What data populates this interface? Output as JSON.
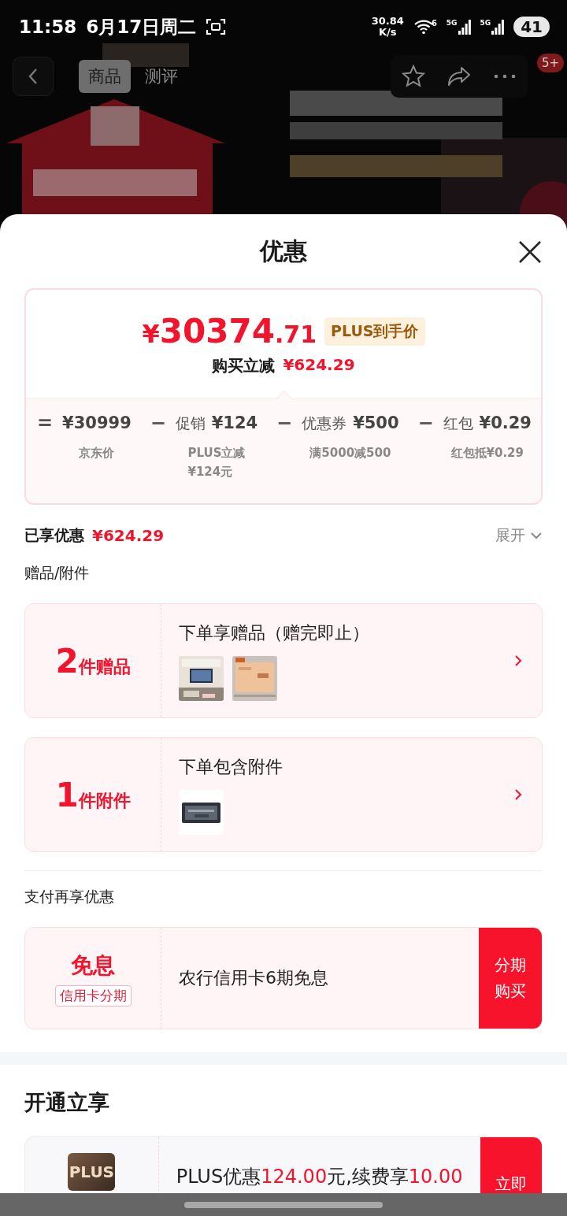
{
  "status_bar": {
    "time": "11:58",
    "date": "6月17日周二",
    "speed_value": "30.84",
    "speed_unit": "K/s",
    "wifi_label": "6",
    "signals": [
      "5G",
      "5G"
    ],
    "battery": "41"
  },
  "nav": {
    "tabs": [
      {
        "label": "商品",
        "selected": true
      },
      {
        "label": "测评",
        "selected": false
      }
    ],
    "badge": "5+"
  },
  "sheet": {
    "title": "优惠"
  },
  "price_card": {
    "price_currency": "¥",
    "price_integer": "30374",
    "price_decimal": ".71",
    "price_tag": "PLUS到手价",
    "discount_label": "购买立减",
    "discount_amount": "¥624.29",
    "breakdown": [
      {
        "operator": "=",
        "amount": "¥30999",
        "note_lines": [
          "京东价"
        ]
      },
      {
        "operator": "−",
        "label": "促销",
        "amount": "¥124",
        "note_lines": [
          "PLUS立减",
          "¥124元"
        ]
      },
      {
        "operator": "−",
        "label": "优惠券",
        "amount": "¥500",
        "note_lines": [
          "满5000减500"
        ]
      },
      {
        "operator": "−",
        "label": "红包",
        "amount": "¥0.29",
        "note_lines": [
          "红包抵¥0.29"
        ]
      }
    ]
  },
  "savings": {
    "label": "已享优惠",
    "amount": "¥624.29",
    "toggle": "展开"
  },
  "gifts_section": {
    "title": "赠品/附件",
    "cards": [
      {
        "count": "2",
        "unit": "件赠品",
        "title": "下单享赠品（赠完即止）"
      },
      {
        "count": "1",
        "unit": "件附件",
        "title": "下单包含附件"
      }
    ]
  },
  "payment_section": {
    "title": "支付再享优惠",
    "card": {
      "badge_title": "免息",
      "badge_tag": "信用卡分期",
      "text": "农行信用卡6期免息",
      "action_lines": [
        "分期",
        "购买"
      ]
    }
  },
  "membership_section": {
    "title": "开通立享",
    "card": {
      "logo": "PLUS",
      "segments": [
        {
          "text": "PLUS优惠",
          "highlight": false
        },
        {
          "text": "124.00",
          "highlight": true
        },
        {
          "text": "元,续费享",
          "highlight": false
        },
        {
          "text": "10.00",
          "highlight": true
        }
      ],
      "action_lines": [
        "立即"
      ]
    }
  }
}
